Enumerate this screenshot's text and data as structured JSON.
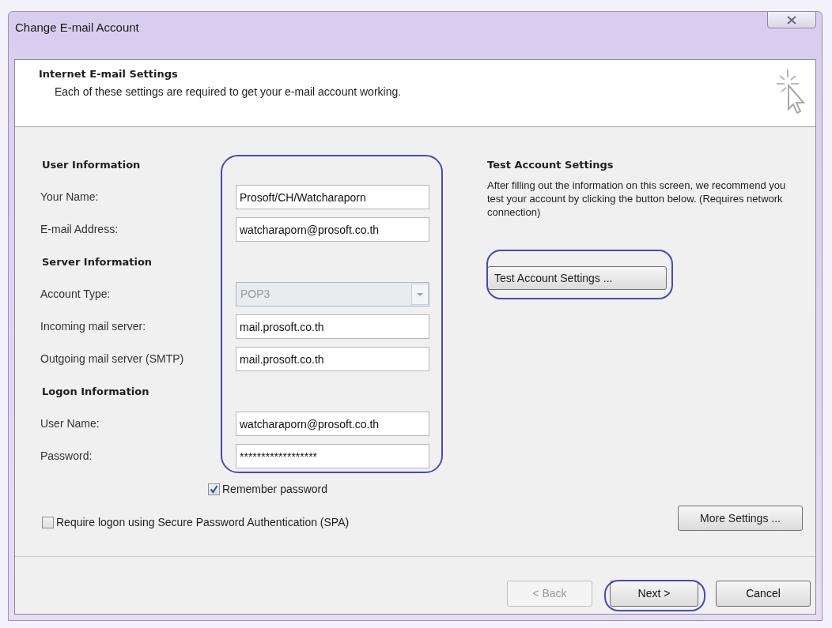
{
  "window": {
    "title": "Change E-mail Account"
  },
  "header": {
    "title": "Internet E-mail Settings",
    "description": "Each of these settings are required to get your e-mail account working."
  },
  "fields_circled": true,
  "sections": [
    {
      "title": "User Information",
      "fields": [
        {
          "label": "Your Name:",
          "kind": "text",
          "value": "Prosoft/CH/Watcharaporn",
          "disabled": false
        },
        {
          "label": "E-mail Address:",
          "kind": "text",
          "value": "watcharaporn@prosoft.co.th",
          "disabled": false
        }
      ]
    },
    {
      "title": "Server Information",
      "fields": [
        {
          "label": "Account Type:",
          "kind": "dropdown",
          "value": "POP3",
          "disabled": true
        },
        {
          "label": "Incoming mail server:",
          "kind": "text",
          "value": "mail.prosoft.co.th",
          "disabled": false
        },
        {
          "label": "Outgoing mail server (SMTP)",
          "kind": "text",
          "value": "mail.prosoft.co.th",
          "disabled": false
        }
      ]
    },
    {
      "title": "Logon Information",
      "fields": [
        {
          "label": "User Name:",
          "kind": "text",
          "value": "watcharaporn@prosoft.co.th",
          "disabled": false
        },
        {
          "label": "Password:",
          "kind": "text",
          "value": "******************",
          "disabled": false
        }
      ]
    }
  ],
  "remember_password": {
    "label": "Remember password",
    "checked": true
  },
  "spa": {
    "label": "Require logon using Secure Password Authentication (SPA)",
    "checked": false
  },
  "test_settings": {
    "title": "Test Account Settings",
    "description": "After filling out the information on this screen, we recommend you test your account by clicking the button below. (Requires network connection)",
    "button": {
      "label": "Test Account Settings ...",
      "circled": true
    }
  },
  "more_settings_button": {
    "label": "More Settings ...",
    "circled": false
  },
  "buttons": [
    {
      "label": "< Back",
      "disabled": true,
      "circled": false
    },
    {
      "label": "Next >",
      "disabled": false,
      "circled": true
    },
    {
      "label": "Cancel",
      "disabled": false,
      "circled": false
    }
  ]
}
